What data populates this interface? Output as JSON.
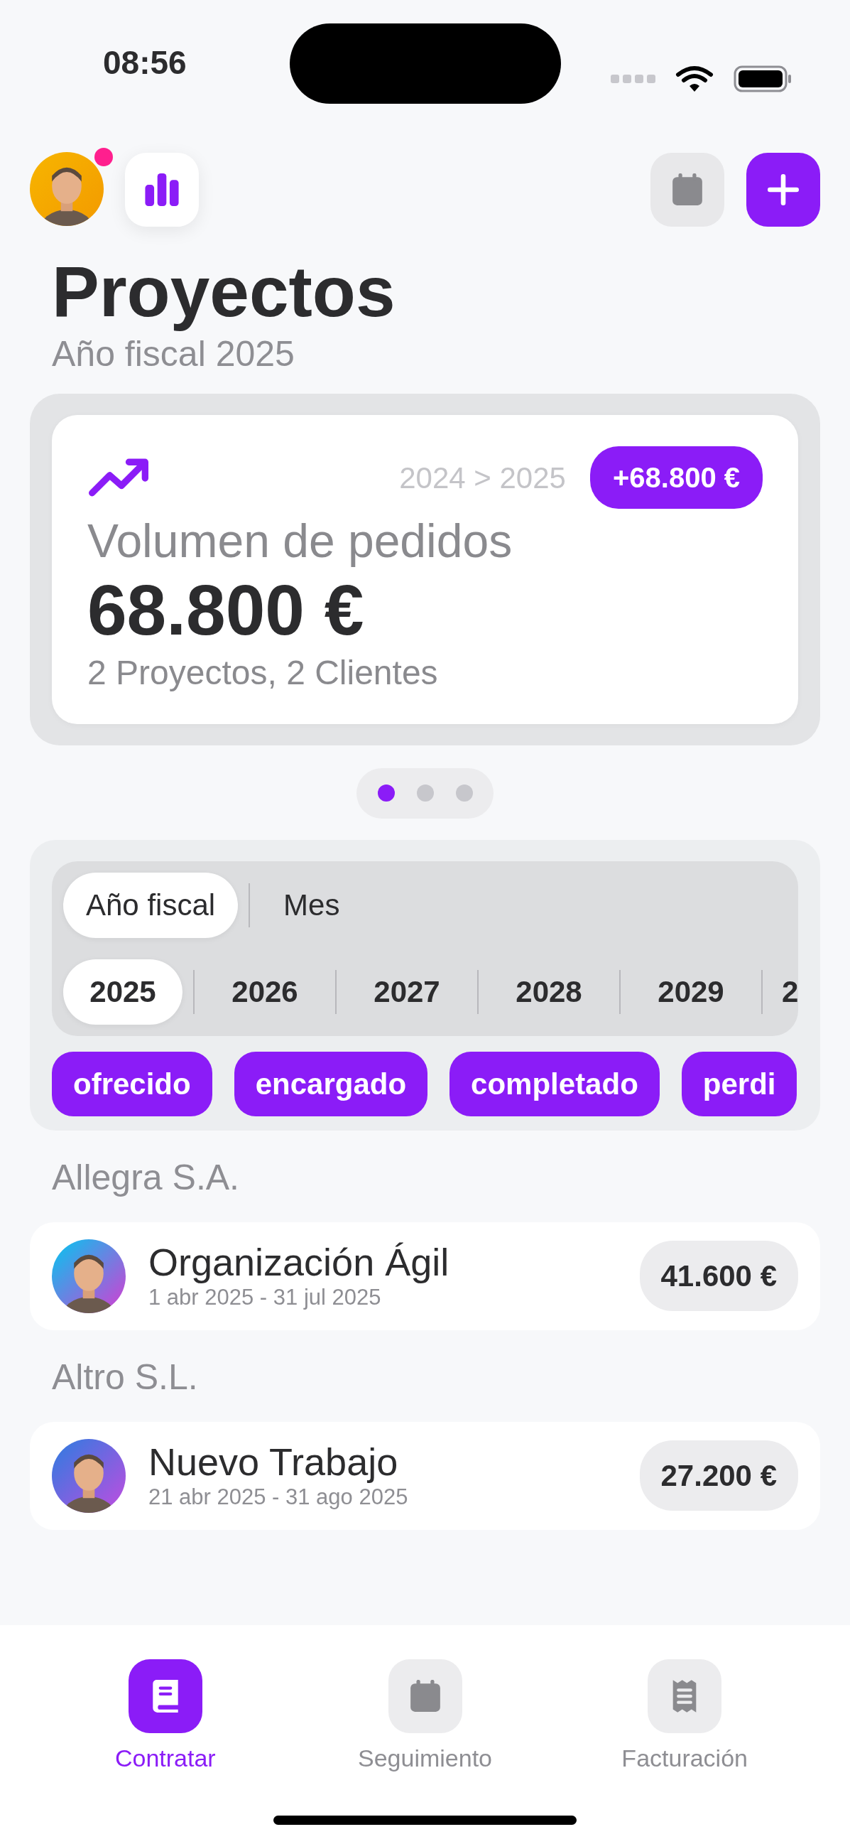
{
  "status_bar": {
    "time": "08:56"
  },
  "header": {
    "notification": true,
    "title": "Proyectos",
    "subtitle": "Año fiscal 2025"
  },
  "summary_card": {
    "comparison": "2024 > 2025",
    "change": "+68.800 €",
    "label": "Volumen de pedidos",
    "value": "68.800 €",
    "detail": "2 Proyectos, 2 Clientes"
  },
  "pager": [
    {
      "selected": true
    },
    {
      "selected": false
    },
    {
      "selected": false
    }
  ],
  "period_modes": [
    {
      "label": "Año fiscal",
      "selected": true
    },
    {
      "label": "Mes",
      "selected": false
    }
  ],
  "years": [
    {
      "label": "2025",
      "selected": true
    },
    {
      "label": "2026",
      "selected": false
    },
    {
      "label": "2027",
      "selected": false
    },
    {
      "label": "2028",
      "selected": false
    },
    {
      "label": "2029",
      "selected": false
    },
    {
      "label": "2",
      "selected": false
    }
  ],
  "status_filters": [
    {
      "label": "ofrecido"
    },
    {
      "label": "encargado"
    },
    {
      "label": "completado"
    },
    {
      "label": "perdi"
    }
  ],
  "groups": [
    {
      "client": "Allegra S.A.",
      "projects": [
        {
          "name": "Organización Ágil",
          "dates": "1 abr 2025 - 31 jul 2025",
          "amount": "41.600 €"
        }
      ]
    },
    {
      "client": "Altro S.L.",
      "projects": [
        {
          "name": "Nuevo Trabajo",
          "dates": "21 abr 2025 - 31 ago 2025",
          "amount": "27.200 €"
        }
      ]
    }
  ],
  "tab_bar": [
    {
      "label": "Contratar",
      "selected": true
    },
    {
      "label": "Seguimiento",
      "selected": false
    },
    {
      "label": "Facturación",
      "selected": false
    }
  ]
}
